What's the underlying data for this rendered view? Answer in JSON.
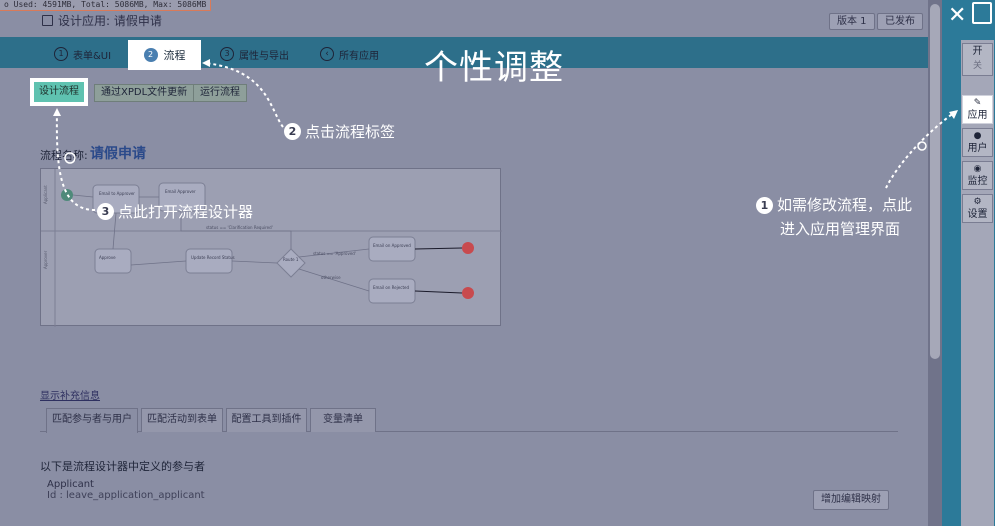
{
  "status_bar": {
    "memory": "o Used: 4591MB, Total: 5086MB, Max: 5086MB"
  },
  "header": {
    "title": "设计应用: 请假申请",
    "version_btn": "版本 1",
    "published_btn": "已发布"
  },
  "tabs": [
    {
      "num": "1",
      "label": "表单&UI"
    },
    {
      "num": "2",
      "label": "流程"
    },
    {
      "num": "3",
      "label": "属性与导出"
    },
    {
      "num": "",
      "label": "所有应用"
    }
  ],
  "overlay_title": "个性调整",
  "actions": {
    "design": "设计流程",
    "xpdl": "通过XPDL文件更新",
    "run": "运行流程"
  },
  "flow": {
    "name_label": "流程名称:",
    "name_value": "请假申请",
    "diagram": {
      "nodes": [
        "Email to Approver",
        "Email Approver",
        "Approve",
        "Update Record Status",
        "Route 1",
        "Email on Approved",
        "Email on Rejected"
      ],
      "transitions": [
        "status == 'Clarification Required'",
        "status == 'Approved'",
        "otherwise"
      ],
      "lanes": [
        "Applicant",
        "Approver"
      ]
    }
  },
  "more_info": "显示补充信息",
  "subtabs": [
    "匹配参与者与用户",
    "匹配活动到表单",
    "配置工具到插件",
    "变量清单"
  ],
  "participants": {
    "title": "以下是流程设计器中定义的参与者",
    "items": [
      {
        "name": "Applicant",
        "id": "Id : leave_application_applicant"
      }
    ],
    "add_map": "增加编辑映射"
  },
  "sidebar": {
    "on": "开",
    "off": "关",
    "items": [
      {
        "icon": "edit-icon",
        "label": "应用"
      },
      {
        "icon": "user-icon",
        "label": "用户"
      },
      {
        "icon": "monitor-icon",
        "label": "监控"
      },
      {
        "icon": "gear-icon",
        "label": "设置"
      }
    ]
  },
  "annotations": {
    "step1_line1": "如需修改流程，点此",
    "step1_line2": "进入应用管理界面",
    "step2": "点击流程标签",
    "step3": "点此打开流程设计器",
    "badges": [
      "1",
      "2",
      "3"
    ]
  }
}
